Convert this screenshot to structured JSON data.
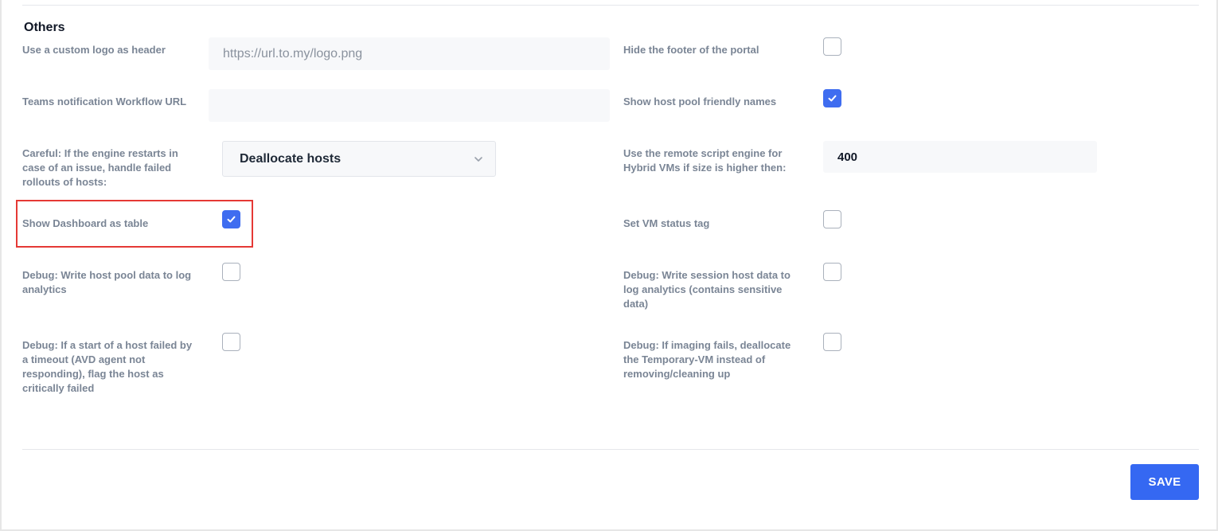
{
  "section": {
    "title": "Others"
  },
  "left": {
    "custom_logo": {
      "label": "Use a custom logo as header",
      "value": "",
      "placeholder": "https://url.to.my/logo.png"
    },
    "teams_url": {
      "label": "Teams notification Workflow URL",
      "value": "",
      "placeholder": ""
    },
    "engine_restart": {
      "label": "Careful: If the engine restarts in case of an issue, handle failed rollouts of hosts:",
      "selected": "Deallocate hosts"
    },
    "dashboard_table": {
      "label": "Show Dashboard as table",
      "checked": true
    },
    "debug_hostpool": {
      "label": "Debug: Write host pool data to log analytics",
      "checked": false
    },
    "debug_start_failed": {
      "label": "Debug: If a start of a host failed by a timeout (AVD agent not responding), flag the host as critically failed",
      "checked": false
    }
  },
  "right": {
    "hide_footer": {
      "label": "Hide the footer of the portal",
      "checked": false
    },
    "friendly_names": {
      "label": "Show host pool friendly names",
      "checked": true
    },
    "remote_script": {
      "label": "Use the remote script engine for Hybrid VMs if size is higher then:",
      "value": "400"
    },
    "vm_status_tag": {
      "label": "Set VM status tag",
      "checked": false
    },
    "debug_session_host": {
      "label": "Debug: Write session host data to log analytics (contains sensitive data)",
      "checked": false
    },
    "debug_imaging": {
      "label": "Debug: If imaging fails, deallocate the Temporary-VM instead of removing/cleaning up",
      "checked": false
    }
  },
  "actions": {
    "save_label": "SAVE"
  },
  "colors": {
    "accent": "#3568f2",
    "highlight": "#e53935",
    "label": "#7a8595"
  },
  "icons": {
    "check": "check-icon",
    "select_arrow": "chevron-down-icon"
  }
}
